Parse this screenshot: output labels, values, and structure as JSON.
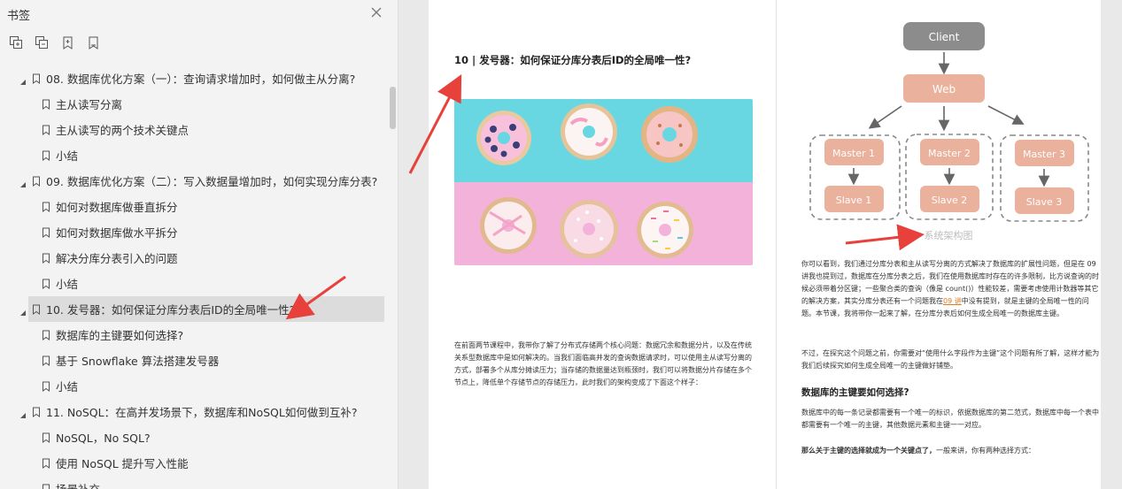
{
  "sidebar": {
    "title": "书签",
    "tools": [
      "expand-all-icon",
      "collapse-all-icon",
      "add-bookmark-icon",
      "bookmark-icon"
    ],
    "items": [
      {
        "level": 1,
        "label": "08. 数据库优化方案（一）：查询请求增加时，如何做主从分离?"
      },
      {
        "level": 2,
        "label": "主从读写分离"
      },
      {
        "level": 2,
        "label": "主从读写的两个技术关键点"
      },
      {
        "level": 2,
        "label": "小结"
      },
      {
        "level": 1,
        "label": "09. 数据库优化方案（二）：写入数据量增加时，如何实现分库分表?"
      },
      {
        "level": 2,
        "label": "如何对数据库做垂直拆分"
      },
      {
        "level": 2,
        "label": "如何对数据库做水平拆分"
      },
      {
        "level": 2,
        "label": "解决分库分表引入的问题"
      },
      {
        "level": 2,
        "label": "小结"
      },
      {
        "level": 1,
        "label": "10. 发号器：如何保证分库分表后ID的全局唯一性?",
        "selected": true
      },
      {
        "level": 2,
        "label": "数据库的主键要如何选择?"
      },
      {
        "level": 2,
        "label": "基于 Snowflake 算法搭建发号器"
      },
      {
        "level": 2,
        "label": "小结"
      },
      {
        "level": 1,
        "label": "11. NoSQL：在高并发场景下，数据库和NoSQL如何做到互补?"
      },
      {
        "level": 2,
        "label": "NoSQL，No SQL?"
      },
      {
        "level": 2,
        "label": "使用 NoSQL 提升写入性能"
      },
      {
        "level": 2,
        "label": "场景补充"
      }
    ]
  },
  "page1": {
    "title": "10 | 发号器：如何保证分库分表后ID的全局唯一性?",
    "para": "在前面两节课程中，我带你了解了分布式存储两个核心问题：数据冗余和数据分片，以及在传统关系型数据库中是如何解决的。当我们面临高并发的查询数据请求时，可以使用主从读写分离的方式，部署多个从库分摊读压力；当存储的数据量达到瓶颈时，我们可以将数据分片存储在多个节点上，降低单个存储节点的存储压力，此时我们的架构变成了下面这个样子："
  },
  "page2": {
    "diagram": {
      "client": "Client",
      "web": "Web",
      "masters": [
        "Master 1",
        "Master 2",
        "Master 3"
      ],
      "slaves": [
        "Slave 1",
        "Slave 2",
        "Slave 3"
      ],
      "caption": "系统架构图"
    },
    "para1_a": "你可以看到，我们通过分库分表和主从读写分离的方式解决了数据库的扩展性问题，但是在 09 讲我也提到过，数据库在分库分表之后，我们在使用数据库时存在的许多限制，比方说查询的时候必须带着分区键；一些聚合类的查询（像是 count()）性能较差，需要考虑使用计数器等其它的解决方案，其实分库分表还有一个问题我在",
    "para1_link": "09 讲",
    "para1_b": "中没有提到，就是主键的全局唯一性的问题。本节课，我将带你一起来了解，在分库分表后如何生成全局唯一的数据库主键。",
    "para2": "不过，在探究这个问题之前，你需要对“使用什么字段作为主键”这个问题有所了解，这样才能为我们后续探究如何生成全局唯一的主键做好铺垫。",
    "heading": "数据库的主键要如何选择?",
    "para3": "数据库中的每一条记录都需要有一个唯一的标识，依据数据库的第二范式，数据库中每一个表中都需要有一个唯一的主键，其他数据元素和主键一一对应。",
    "para4_bold": "那么关于主键的选择就成为一个关键点了，",
    "para4": "一般来讲，你有两种选择方式："
  },
  "colors": {
    "accent_arrow": "#e8403a",
    "node_fill": "#eab19c",
    "client_fill": "#8c8c8c",
    "link": "#e07b20"
  }
}
